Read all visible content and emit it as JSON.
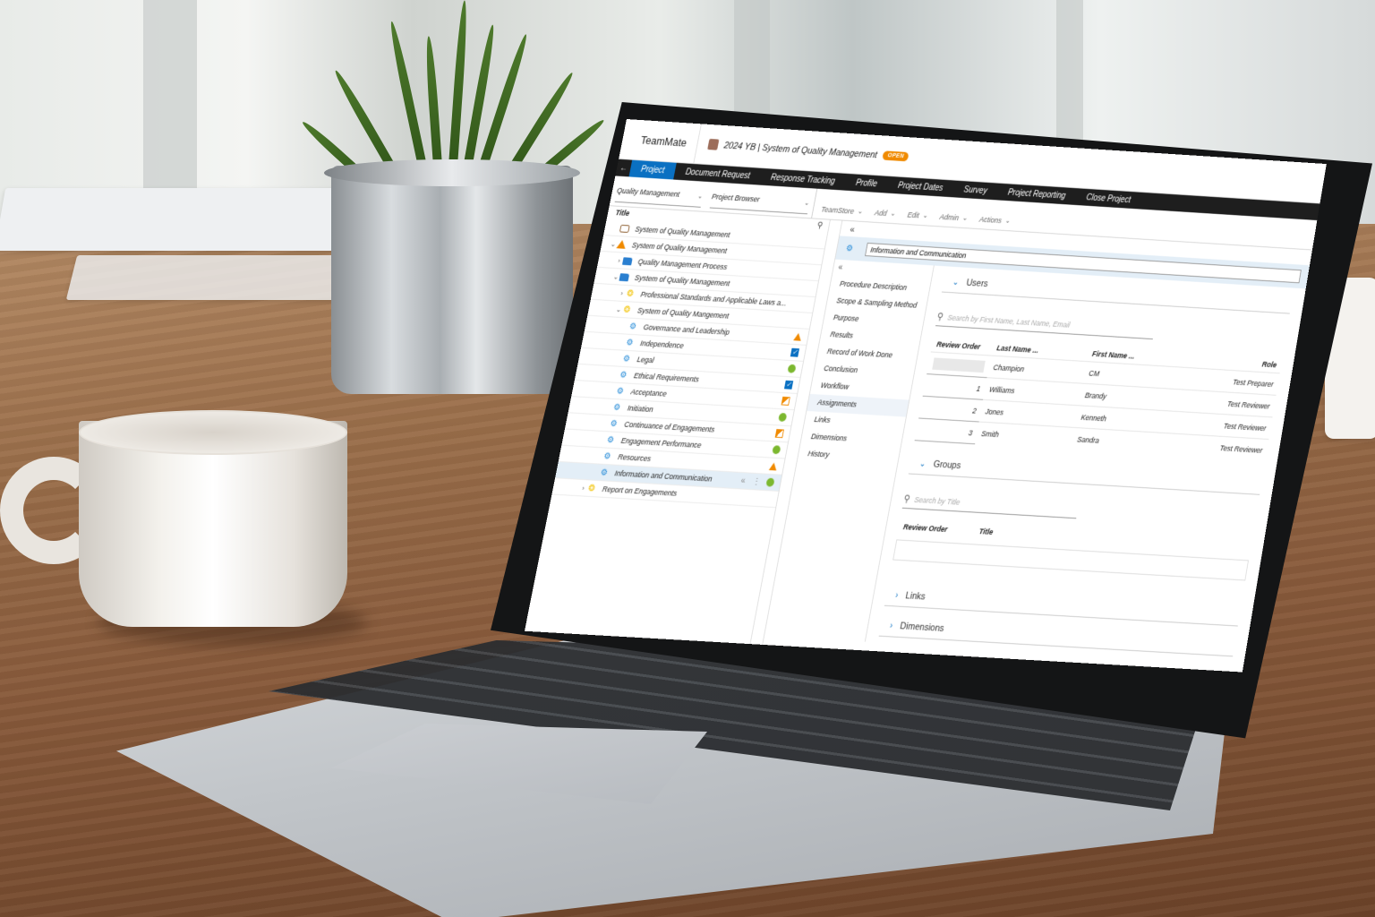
{
  "app": {
    "name": "TeamMate",
    "project_title": "2024 YB | System of Quality Management",
    "status_badge": "OPEN",
    "accent_color": "#0a70c2",
    "badge_color": "#f08a00"
  },
  "nav": {
    "back_icon": "arrow-left-icon",
    "items": [
      {
        "label": "Project",
        "active": true
      },
      {
        "label": "Document Request",
        "active": false
      },
      {
        "label": "Response Tracking",
        "active": false
      },
      {
        "label": "Profile",
        "active": false
      },
      {
        "label": "Project Dates",
        "active": false
      },
      {
        "label": "Survey",
        "active": false
      },
      {
        "label": "Project Reporting",
        "active": false
      },
      {
        "label": "Close Project",
        "active": false
      }
    ]
  },
  "toolbar": {
    "view_select": "Quality Management",
    "browser_select": "Project Browser",
    "menus": [
      "TeamStore",
      "Add",
      "Edit",
      "Admin",
      "Actions"
    ]
  },
  "tree": {
    "column_title": "Title",
    "rows": [
      {
        "label": "System of Quality Management",
        "icon": "briefcase-icon",
        "indent": 0,
        "toggle": "",
        "status": ""
      },
      {
        "label": "System of Quality Management",
        "icon": "warning-triangle-icon",
        "indent": 0,
        "toggle": "expanded",
        "status": ""
      },
      {
        "label": "Quality Management Process",
        "icon": "folder-icon",
        "indent": 1,
        "toggle": "collapsed",
        "status": ""
      },
      {
        "label": "System of Quality Management",
        "icon": "folder-icon",
        "indent": 1,
        "toggle": "expanded",
        "status": ""
      },
      {
        "label": "Professional Standards and Applicable Laws a...",
        "icon": "lightbulb-icon",
        "indent": 2,
        "toggle": "collapsed",
        "status": ""
      },
      {
        "label": "System of Quality Mangement",
        "icon": "lightbulb-icon",
        "indent": 2,
        "toggle": "expanded",
        "status": ""
      },
      {
        "label": "Governance and Leadership",
        "icon": "gear-icon",
        "indent": 3,
        "toggle": "",
        "status": "triangle"
      },
      {
        "label": "Independence",
        "icon": "gear-icon",
        "indent": 3,
        "toggle": "",
        "status": "check"
      },
      {
        "label": "Legal",
        "icon": "gear-icon",
        "indent": 3,
        "toggle": "",
        "status": "dot"
      },
      {
        "label": "Ethical Requirements",
        "icon": "gear-icon",
        "indent": 3,
        "toggle": "",
        "status": "check"
      },
      {
        "label": "Acceptance",
        "icon": "gear-icon",
        "indent": 3,
        "toggle": "",
        "status": "partial"
      },
      {
        "label": "Initiation",
        "icon": "gear-icon",
        "indent": 3,
        "toggle": "",
        "status": "dot"
      },
      {
        "label": "Continuance of Engagements",
        "icon": "gear-icon",
        "indent": 3,
        "toggle": "",
        "status": "partial"
      },
      {
        "label": "Engagement Performance",
        "icon": "gear-icon",
        "indent": 3,
        "toggle": "",
        "status": "dot"
      },
      {
        "label": "Resources",
        "icon": "gear-icon",
        "indent": 3,
        "toggle": "",
        "status": "triangle"
      },
      {
        "label": "Information and Communication",
        "icon": "gear-icon",
        "indent": 3,
        "toggle": "",
        "status": "dot",
        "selected": true
      },
      {
        "label": "Report on Engagements",
        "icon": "lightbulb-icon",
        "indent": 2,
        "toggle": "collapsed",
        "status": ""
      }
    ]
  },
  "detail": {
    "title_value": "Information and Communication",
    "sections": [
      "Procedure Description",
      "Scope & Sampling Method",
      "Purpose",
      "Results",
      "Record of Work Done",
      "Conclusion",
      "Workflow",
      "Assignments",
      "Links",
      "Dimensions",
      "History"
    ],
    "active_section": "Assignments",
    "users": {
      "heading": "Users",
      "search_placeholder": "Search by First Name, Last Name, Email",
      "columns": [
        "Review Order",
        "Last Name ...",
        "First Name ...",
        "Role"
      ],
      "rows": [
        {
          "order": "",
          "last": "Champion",
          "first": "CM",
          "role": "Test Preparer"
        },
        {
          "order": "1",
          "last": "Williams",
          "first": "Brandy",
          "role": "Test Reviewer"
        },
        {
          "order": "2",
          "last": "Jones",
          "first": "Kenneth",
          "role": "Test Reviewer"
        },
        {
          "order": "3",
          "last": "Smith",
          "first": "Sandra",
          "role": "Test Reviewer"
        }
      ]
    },
    "groups": {
      "heading": "Groups",
      "search_placeholder": "Search by Title",
      "columns": [
        "Review Order",
        "Title"
      ]
    },
    "links_heading": "Links",
    "dimensions_heading": "Dimensions"
  }
}
